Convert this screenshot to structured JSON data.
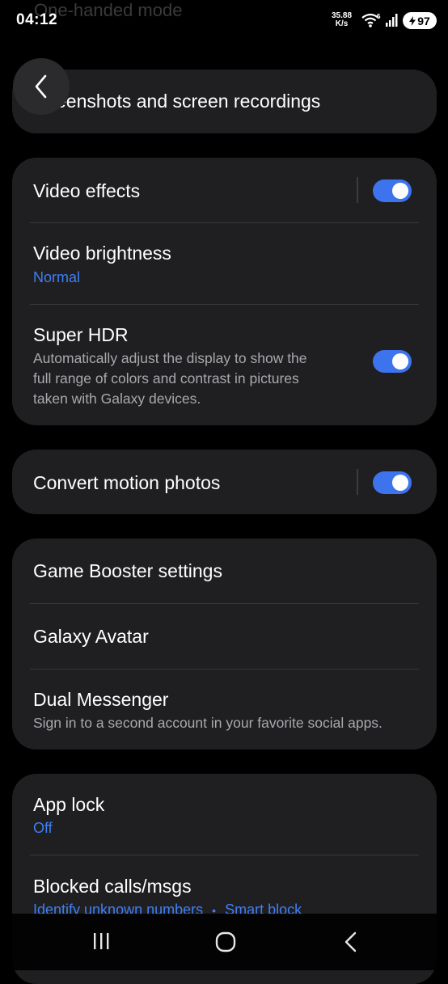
{
  "status": {
    "time": "04:12",
    "net_speed": "35.88",
    "net_unit": "K/s",
    "wifi_badge": "5",
    "battery": "97"
  },
  "background_title": "One-handed mode",
  "header": {
    "title": "Screenshots and screen recordings",
    "title_visible": "eenshots and screen recordings"
  },
  "card1": {
    "video_effects": {
      "title": "Video effects",
      "toggle_on": true
    },
    "video_brightness": {
      "title": "Video brightness",
      "value": "Normal"
    },
    "super_hdr": {
      "title": "Super HDR",
      "desc_line1": "Automatically adjust the display to show the",
      "desc_line2": "full range of colors and contrast in pictures",
      "desc_line3": "taken with Galaxy devices.",
      "toggle_on": true
    }
  },
  "card2": {
    "convert_motion": {
      "title": "Convert motion photos",
      "toggle_on": true
    }
  },
  "card3": {
    "game_booster": {
      "title": "Game Booster settings"
    },
    "galaxy_avatar": {
      "title": "Galaxy Avatar"
    },
    "dual_messenger": {
      "title": "Dual Messenger",
      "desc": "Sign in to a second account in your favorite social apps."
    }
  },
  "card4": {
    "app_lock": {
      "title": "App lock",
      "value": "Off"
    },
    "blocked": {
      "title": "Blocked calls/msgs",
      "value1": "Identify unknown numbers",
      "separator": "•",
      "value2": "Smart block"
    }
  },
  "colors": {
    "accent": "#3f7ff5",
    "toggle": "#3e73ee",
    "card": "#1f1f21",
    "background": "#000000"
  },
  "icons": {
    "back": "chevron-left-icon",
    "nav_recents": "recents-icon",
    "nav_home": "home-icon",
    "nav_back": "back-icon"
  }
}
